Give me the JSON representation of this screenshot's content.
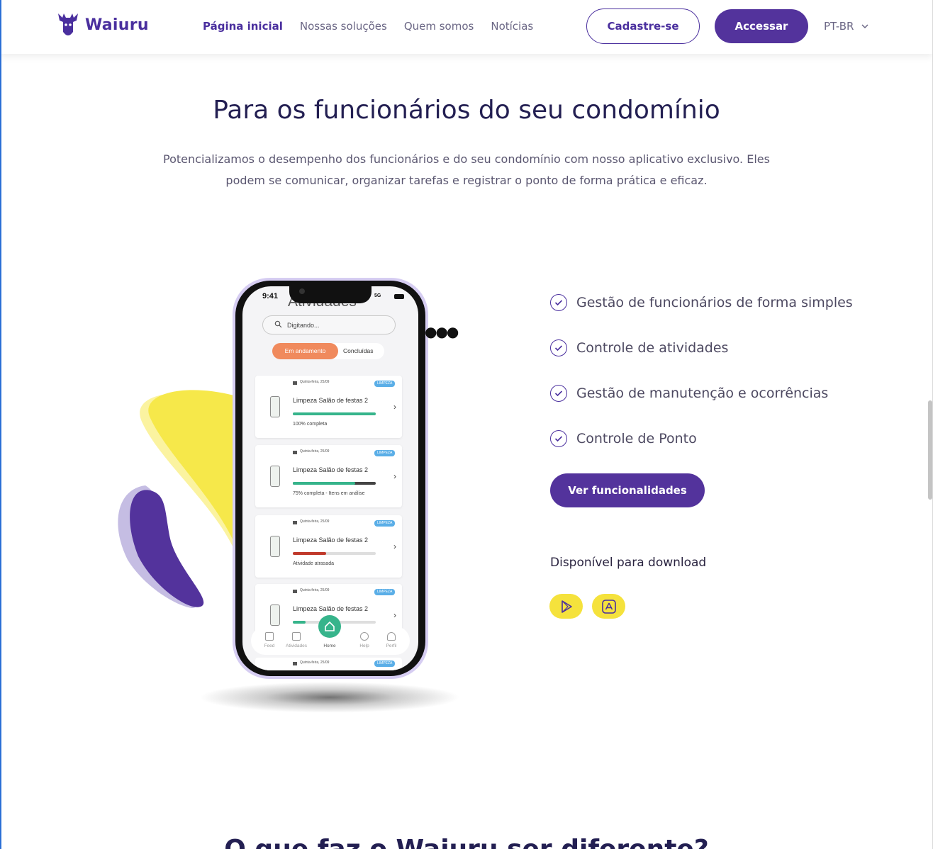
{
  "brand": {
    "name": "Waiuru",
    "color": "#4a2f9e",
    "accent_yellow": "#f5e23c"
  },
  "nav": {
    "items": [
      {
        "label": "Página inicial",
        "active": true
      },
      {
        "label": "Nossas soluções",
        "active": false
      },
      {
        "label": "Quem somos",
        "active": false
      },
      {
        "label": "Notícias",
        "active": false
      }
    ],
    "signup_label": "Cadastre-se",
    "login_label": "Accessar",
    "language": "PT-BR"
  },
  "hero": {
    "title": "Para os funcionários do seu condomínio",
    "subtitle": "Potencializamos o desempenho dos funcionários e do seu condomínio com nosso aplicativo exclusivo. Eles podem se comunicar, organizar tarefas e registrar o ponto de forma prática e eficaz."
  },
  "phone_app": {
    "time": "9:41",
    "network": "5G",
    "screen_title": "Atividades",
    "search_placeholder": "Digitando...",
    "segments": {
      "active": "Em andamento",
      "inactive": "Concluídas"
    },
    "cards": [
      {
        "date": "Quinta-feira, 25/09",
        "badge": "LIMPEZA",
        "title": "Limpeza Salão de festas 2",
        "progress": 1.0,
        "progress_color": "#36b48b",
        "status": "100% completa"
      },
      {
        "date": "Quinta-feira, 25/09",
        "badge": "LIMPEZA",
        "title": "Limpeza Salão de festas 2",
        "progress": 0.75,
        "progress_color": "#36b48b",
        "status": "75% completa - Itens em análise"
      },
      {
        "date": "Quinta-feira, 25/09",
        "badge": "LIMPEZA",
        "title": "Limpeza Salão de festas 2",
        "progress": 0.4,
        "progress_color": "#c0392b",
        "status": "Atividade atrasada"
      },
      {
        "date": "Quinta-feira, 25/09",
        "badge": "LIMPEZA",
        "title": "Limpeza Salão de festas 2",
        "progress": 0.15,
        "progress_color": "#36b48b",
        "status": ""
      }
    ],
    "peek_card": {
      "date": "Quinta-feira, 25/09",
      "badge": "LIMPEZA"
    },
    "tabs": [
      "Feed",
      "Atividades",
      "Home",
      "Help",
      "Perfil"
    ]
  },
  "features": {
    "items": [
      "Gestão de funcionários de forma simples",
      "Controle de atividades",
      "Gestão de manutenção e ocorrências",
      "Controle de Ponto"
    ],
    "button_label": "Ver funcionalidades",
    "download_label": "Disponível para download",
    "stores": [
      "google-play-icon",
      "app-store-icon"
    ]
  },
  "next_section": {
    "title": "O que faz o Waiuru ser diferente?"
  }
}
